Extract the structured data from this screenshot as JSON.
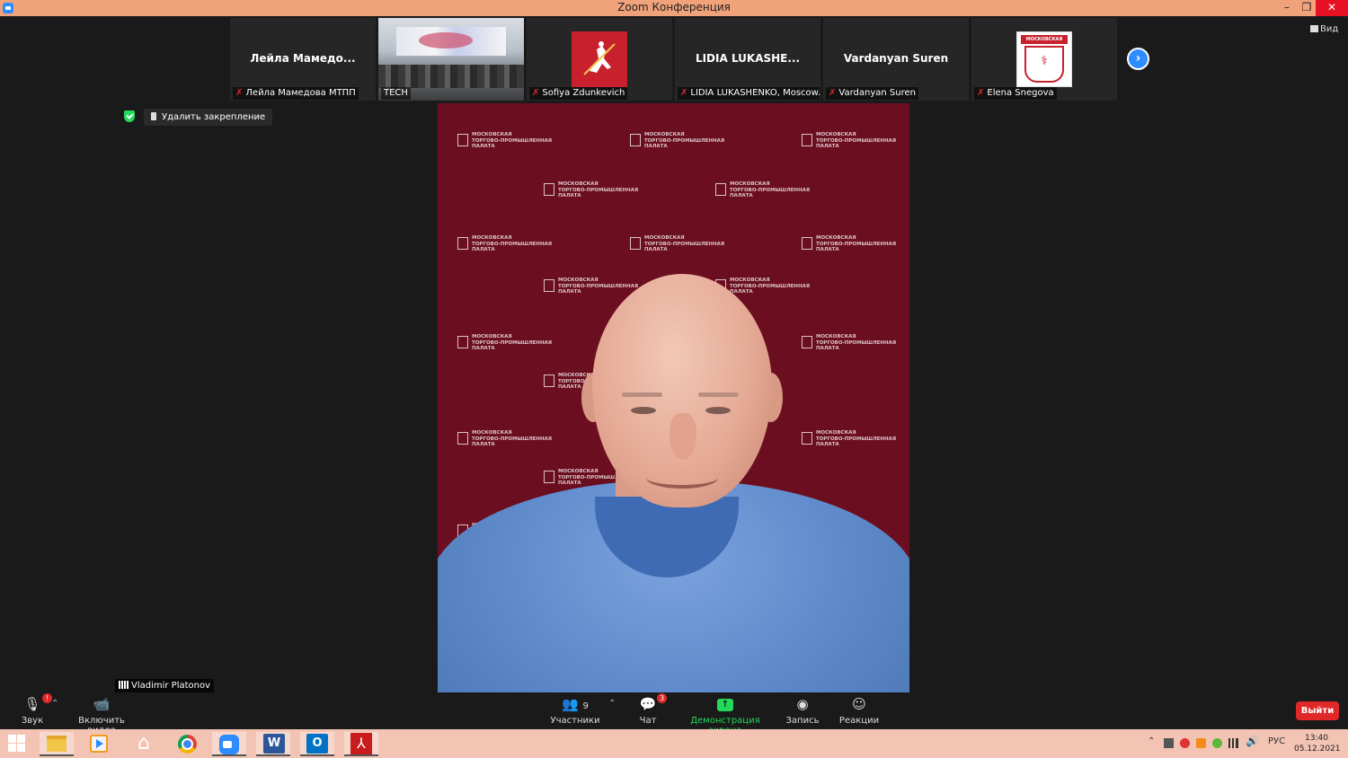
{
  "window": {
    "title": "Zoom Конференция",
    "min_glyph": "–",
    "max_glyph": "❐",
    "close_glyph": "✕"
  },
  "thumbnails": [
    {
      "display_name": "Лейла  Мамедо...",
      "label": "Лейла Мамедова МТПП",
      "muted": true,
      "kind": "name"
    },
    {
      "display_name": "",
      "label": "TECH",
      "muted": false,
      "kind": "video"
    },
    {
      "display_name": "",
      "label": "Sofiya Zdunkevich",
      "muted": true,
      "kind": "moscow-emblem"
    },
    {
      "display_name": "LIDIA  LUKASHE...",
      "label": "LIDIA LUKASHENKO, Moscow...",
      "muted": true,
      "kind": "name"
    },
    {
      "display_name": "Vardanyan Suren",
      "label": "Vardanyan Suren",
      "muted": true,
      "kind": "name"
    },
    {
      "display_name": "",
      "label": "Elena Snegova",
      "muted": true,
      "kind": "mtpp-badge"
    }
  ],
  "mtpp_badge_text": "МОСКОВСКАЯ",
  "view_button": "Вид",
  "unpin_label": "Удалить закрепление",
  "main_speaker": {
    "name": "Vladimir Platonov"
  },
  "background_logo": {
    "line1": "МОСКОВСКАЯ",
    "line2": "ТОРГОВО-ПРОМЫШЛЕННАЯ",
    "line3": "ПАЛАТА"
  },
  "toolbar": {
    "audio_label": "Звук",
    "audio_badge": "!",
    "video_label": "Включить видео",
    "participants_label": "Участники",
    "participants_count": "9",
    "chat_label": "Чат",
    "chat_badge": "3",
    "share_label": "Демонстрация экрана",
    "record_label": "Запись",
    "reactions_label": "Реакции",
    "exit_label": "Выйти",
    "caret": "⌃"
  },
  "taskbar": {
    "language": "РУС",
    "time": "13:40",
    "date": "05.12.2021",
    "tray_caret": "⌃"
  },
  "colors": {
    "title_bar": "#f0a27a",
    "zoom_blue": "#2d8cff",
    "share_green": "#23d959",
    "exit_red": "#e02828",
    "backdrop": "#6b0f20",
    "taskbar": "#f3c4b4"
  }
}
